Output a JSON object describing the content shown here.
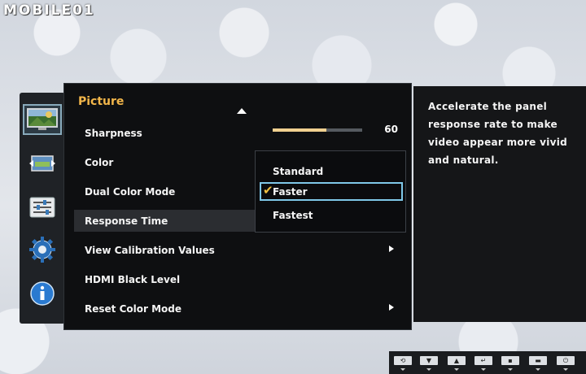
{
  "watermark": "MOBILE01",
  "menu": {
    "title": "Picture",
    "items": [
      {
        "label": "Sharpness",
        "value": "60",
        "level": 0.6
      },
      {
        "label": "Color"
      },
      {
        "label": "Dual Color Mode"
      },
      {
        "label": "Response Time",
        "selected": true
      },
      {
        "label": "View Calibration Values",
        "has_submenu": true
      },
      {
        "label": "HDMI Black Level"
      },
      {
        "label": "Reset Color Mode",
        "has_submenu": true
      }
    ]
  },
  "dropdown": {
    "options": [
      "Standard",
      "Faster",
      "Fastest"
    ],
    "selected": "Faster"
  },
  "description": "Accelerate the panel response rate to make video appear more vivid and natural.",
  "side_icons": [
    "picture-icon",
    "screen-size-icon",
    "settings-sliders-icon",
    "gear-icon",
    "info-icon"
  ],
  "bottom_keys": [
    "rotate-icon",
    "down-arrow-icon",
    "up-arrow-icon",
    "enter-icon",
    "source-icon",
    "pip-icon",
    "power-icon"
  ],
  "colors": {
    "title": "#f2b64a",
    "highlight": "#7fc8e8",
    "slider": "#f0d090"
  }
}
